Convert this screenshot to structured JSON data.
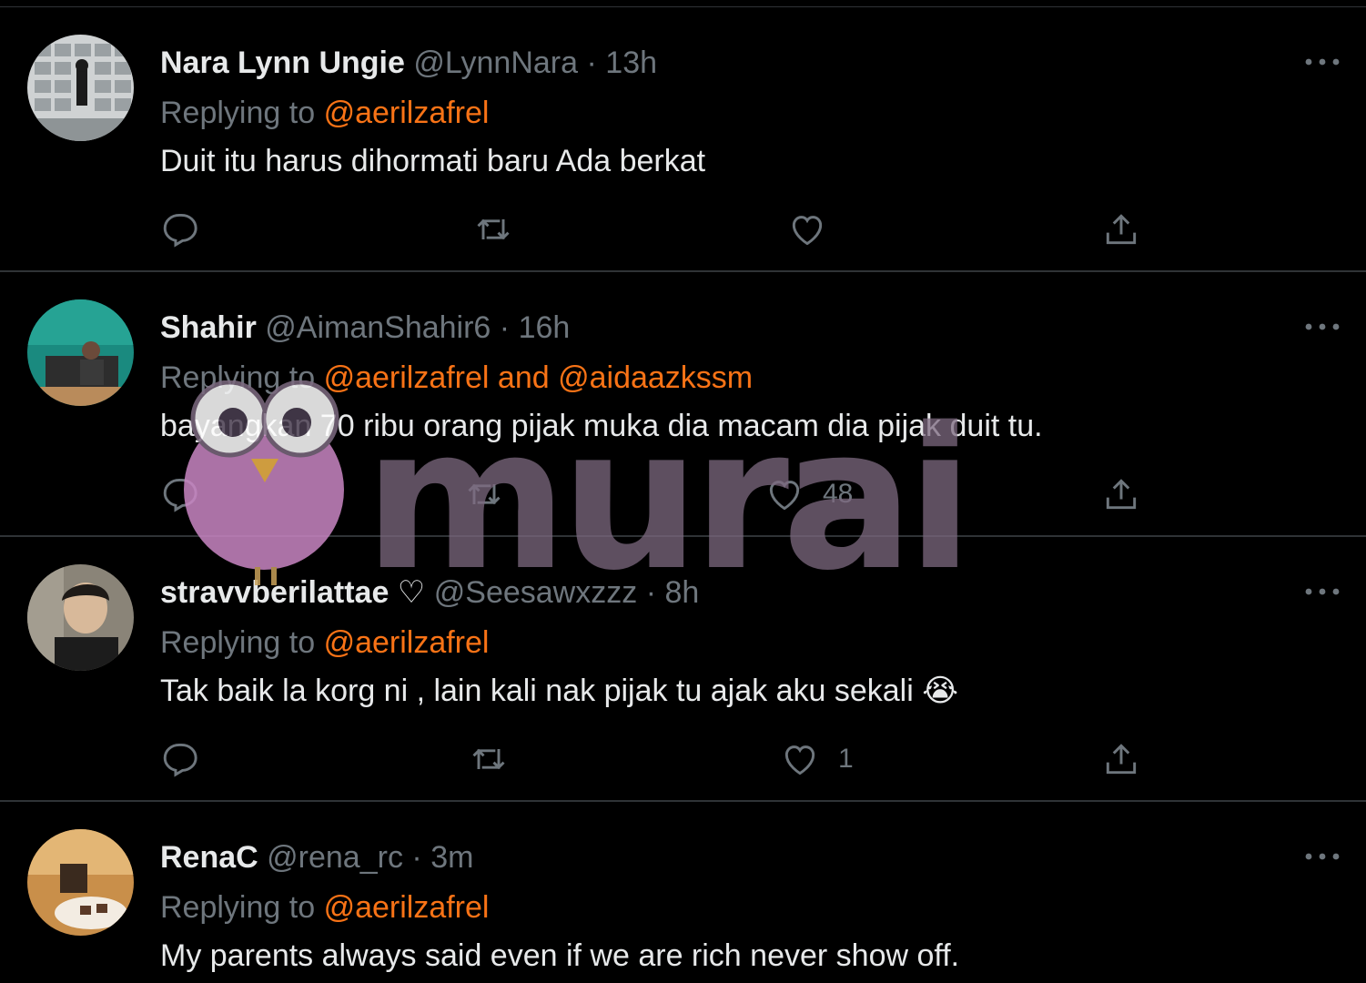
{
  "reply_prefix": "Replying to",
  "watermark_text": "murai",
  "tweets": [
    {
      "name": "Nara Lynn Ungie",
      "handle": "@LynnNara",
      "time": "13h",
      "mentions": "@aerilzafrel",
      "text": "Duit itu harus dihormati baru Ada berkat",
      "like_count": ""
    },
    {
      "name": "Shahir",
      "handle": "@AimanShahir6",
      "time": "16h",
      "mentions": "@aerilzafrel and @aidaazkssm",
      "text": "bayangkan 70 ribu orang pijak muka dia macam dia pijak duit tu.",
      "like_count": "48"
    },
    {
      "name": "stravvberilattae ♡",
      "handle": "@Seesawxzzz",
      "time": "8h",
      "mentions": "@aerilzafrel",
      "text": "Tak baik la korg ni , lain kali nak pijak tu ajak aku sekali 😭",
      "like_count": "1"
    },
    {
      "name": "RenaC",
      "handle": "@rena_rc",
      "time": "3m",
      "mentions": "@aerilzafrel",
      "text": "My parents always said even if we are rich never show off.",
      "like_count": ""
    }
  ],
  "colors": {
    "background": "#000000",
    "muted": "#6e767d",
    "mention": "#f97316",
    "divider": "#2f3336"
  }
}
